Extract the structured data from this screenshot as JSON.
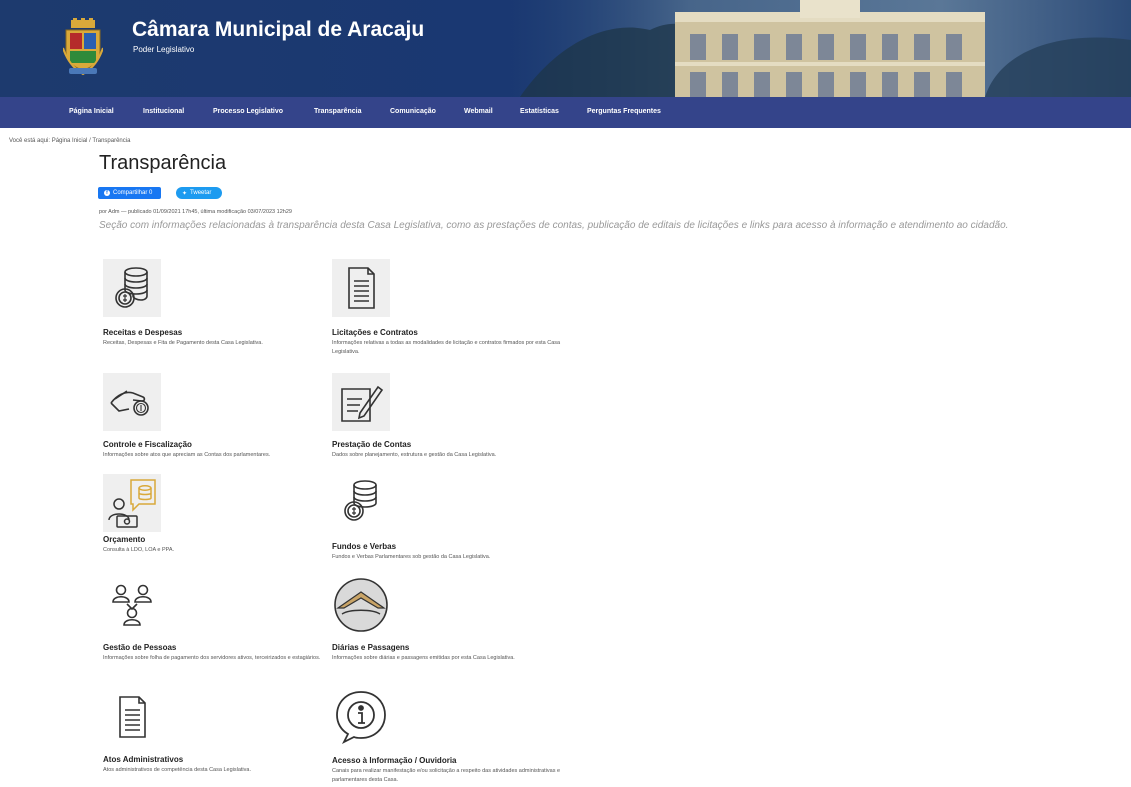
{
  "header": {
    "title": "Câmara Municipal de Aracaju",
    "subtitle": "Poder Legislativo",
    "crest_icon": "municipal-coat-of-arms-icon",
    "colors": {
      "header_bg": "#1d3a6e",
      "nav_bg": "#34448a"
    }
  },
  "nav": {
    "items": [
      "Página Inicial",
      "Institucional",
      "Processo Legislativo",
      "Transparência",
      "Comunicação",
      "Webmail",
      "Estatísticas",
      "Perguntas Frequentes"
    ]
  },
  "breadcrumb": {
    "prefix": "Você está aqui:",
    "home": "Página Inicial",
    "separator": "/",
    "current": "Transparência"
  },
  "page": {
    "title": "Transparência",
    "share_facebook": "Compartilhar 0",
    "share_twitter": "Tweetar",
    "byline": "por Adm — publicado 01/09/2021 17h45, última modificação 03/07/2023 12h29",
    "intro": "Seção com informações relacionadas à transparência desta Casa Legislativa, como as prestações de contas, publicação de editais de licitações e links para acesso à informação e atendimento ao cidadão."
  },
  "tiles": [
    {
      "icon": "coins-stack-icon",
      "title": "Receitas e Despesas",
      "desc": "Receitas, Despesas e Fita de Pagamento desta Casa Legislativa."
    },
    {
      "icon": "document-icon",
      "title": "Licitações e Contratos",
      "desc": "Informações relativas a todas as modalidades de licitação e contratos firmados por esta Casa Legislativa."
    },
    {
      "icon": "hand-coin-icon",
      "title": "Controle e Fiscalização",
      "desc": "Informações sobre atos que apreciam as Contas dos parlamentares."
    },
    {
      "icon": "document-pen-icon",
      "title": "Prestação de Contas",
      "desc": "Dados sobre planejamento, estrutura e gestão da Casa Legislativa."
    },
    {
      "icon": "budget-person-icon",
      "title": "Orçamento",
      "desc": "Consulta à LDO, LOA e PPA."
    },
    {
      "icon": "coins-stack-icon",
      "title": "Fundos e Verbas",
      "desc": "Fundos e Verbas Parlamentares sob gestão da Casa Legislativa."
    },
    {
      "icon": "people-network-icon",
      "title": "Gestão de Pessoas",
      "desc": "Informações sobre folha de pagamento dos servidores ativos, terceirizados e estagiários."
    },
    {
      "icon": "plane-road-icon",
      "title": "Diárias e Passagens",
      "desc": "Informações sobre diárias e passagens emitidas por esta Casa Legislativa."
    },
    {
      "icon": "document-icon",
      "title": "Atos Administrativos",
      "desc": "Atos administrativos de competência desta Casa Legislativa."
    },
    {
      "icon": "info-icon",
      "title": "Acesso à Informação / Ouvidoria",
      "desc": "Canais para realizar manifestação e/ou solicitação a respeito das atividades administrativas e parlamentares desta Casa."
    }
  ]
}
